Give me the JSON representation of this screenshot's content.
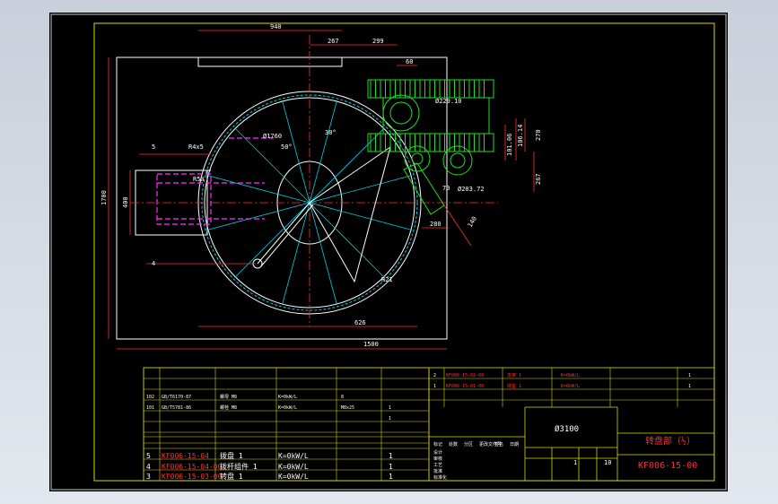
{
  "drawing": {
    "title_cn": "转盘部（½）",
    "drawing_no": "KF006-15-00",
    "diameter_label": "Ø3100",
    "scale_row": [
      "1",
      "10"
    ]
  },
  "dimensions": {
    "d940": "940",
    "d267_top": "267",
    "d299": "299",
    "d60": "60",
    "d270": "270",
    "d267_side": "267",
    "d1700": "1700",
    "d400": "400",
    "d1500": "1500",
    "d626": "626",
    "d280": "280",
    "d140": "140",
    "r4x5": "R4x5",
    "r50": "R50",
    "phi1760": "Ø1760",
    "a50": "50°",
    "a30": "30°",
    "phi203": "Ø203.72",
    "phi229": "Ø229.10",
    "d101": "101.06",
    "d106": "106.14",
    "d70": "70",
    "r21": "R21",
    "leader4": "4",
    "leader5": "5"
  },
  "bom_rows": [
    {
      "no": "102",
      "code": "GB/T6170-87",
      "name": "螺母 M8",
      "qty": "K=0kW/L",
      "mat": "8",
      "extra": ""
    },
    {
      "no": "101",
      "code": "GB/T5781-86",
      "name": "螺栓 M8",
      "qty": "K=0kW/L",
      "mat": "M8x25",
      "extra": "1"
    },
    {
      "no": "",
      "code": "",
      "name": "",
      "qty": "",
      "mat": "",
      "extra": "1"
    },
    {
      "no": "5",
      "code": "KF006-15-04",
      "name": "拨盘 1",
      "qty": "K=0kW/L",
      "mat": "",
      "extra": "1"
    },
    {
      "no": "4",
      "code": "KF006-15-04-00",
      "name": "拨杆组件 1",
      "qty": "K=0kW/L",
      "mat": "",
      "extra": "1"
    },
    {
      "no": "3",
      "code": "KF006-15-03-00",
      "name": "转盘 1",
      "qty": "K=0kW/L",
      "mat": "",
      "extra": "1"
    }
  ],
  "bom_right_rows": [
    {
      "no": "2",
      "code": "KF006-15-02-00",
      "name": "支架 1",
      "qty": "K=0kW/L",
      "extra": "1"
    },
    {
      "no": "1",
      "code": "KF006-15-01-00",
      "name": "底座 1",
      "qty": "K=0kW/L",
      "extra": "1"
    }
  ],
  "bom_header": [
    "序号",
    "代号",
    "名称",
    "数量",
    "材料",
    "单件",
    "总计",
    "备注"
  ],
  "title_labels": [
    "标记",
    "处数",
    "分区",
    "更改文件号",
    "签名",
    "日期"
  ],
  "title_labels2": [
    "设计",
    "审核",
    "工艺",
    "批准",
    "标准化"
  ],
  "colors": {
    "frame": "#d8d800",
    "dim": "#ff3030",
    "part": "#ffffff",
    "center": "#ff3030",
    "hidden": "#ff30ff",
    "chain": "#22dd22",
    "cyan": "#00d0e0",
    "title": "#ff3030"
  }
}
